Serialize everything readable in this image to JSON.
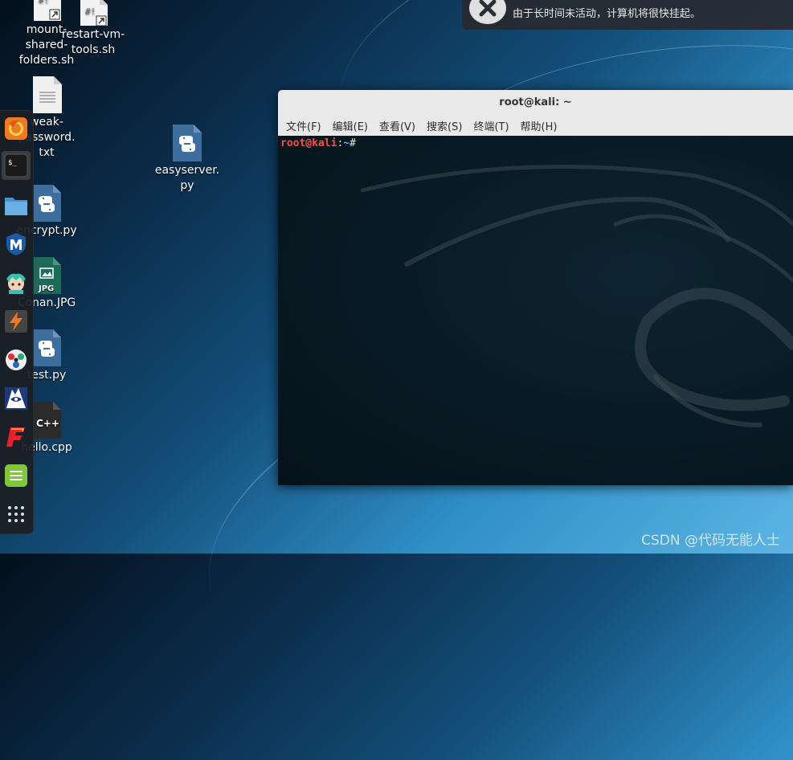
{
  "notification": {
    "icon": "sleep-warning-icon",
    "text": "由于长时间未活动，计算机将很快挂起。"
  },
  "terminal": {
    "title": "root@kali: ~",
    "menu": [
      "文件(F)",
      "编辑(E)",
      "查看(V)",
      "搜索(S)",
      "终端(T)",
      "帮助(H)"
    ],
    "prompt_user": "root@kali",
    "prompt_sep": ":",
    "prompt_path": "~",
    "prompt_symbol": "#"
  },
  "dock": {
    "items": [
      {
        "name": "firefox-icon",
        "active": false
      },
      {
        "name": "terminal-icon",
        "active": true
      },
      {
        "name": "files-icon",
        "active": false
      },
      {
        "name": "metasploit-icon",
        "active": false
      },
      {
        "name": "armitage-icon",
        "active": false
      },
      {
        "name": "burpsuite-icon",
        "active": false
      },
      {
        "name": "maltego-icon",
        "active": false
      },
      {
        "name": "beef-icon",
        "active": false
      },
      {
        "name": "faraday-icon",
        "active": false
      },
      {
        "name": "leafpad-icon",
        "active": false
      },
      {
        "name": "show-applications-icon",
        "active": false
      }
    ]
  },
  "desktop_icons": {
    "mount": "mount-\nshared-\nfolders.sh",
    "restart": "restart-vm-\ntools.sh",
    "weak": "weak-\npassword.\ntxt",
    "encrypt": "encrypt.py",
    "conan": "Conan.JPG",
    "test": "test.py",
    "hello": "hello.cpp",
    "easyserver": "easyserver.\npy"
  },
  "icon_text": {
    "script": "#!",
    "jpg": "JPG",
    "cpp": "C++",
    "shell": "$_"
  },
  "watermark": "CSDN @代码无能人士",
  "colors": {
    "prompt_user": "#ff4b4b",
    "prompt_path": "#5fa8ff",
    "python_file": "#3d6e9e",
    "jpg_file": "#1e6b5a"
  }
}
